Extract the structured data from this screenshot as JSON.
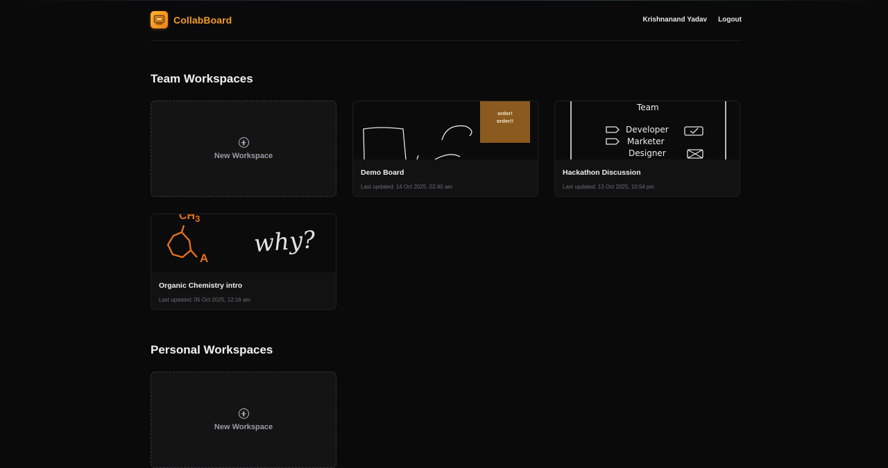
{
  "app": {
    "name": "CollabBoard",
    "brand_color": "#f39a2a"
  },
  "nav": {
    "user_name": "Krishnanand Yadav",
    "logout_label": "Logout"
  },
  "sections": {
    "team": {
      "title": "Team Workspaces",
      "new_label": "New Workspace",
      "boards": [
        {
          "title": "Demo Board",
          "updated": "Last updated: 14 Oct 2025, 02:40 am"
        },
        {
          "title": "Hackathon Discussion",
          "updated": "Last updated: 13 Oct 2025, 10:54 pm"
        },
        {
          "title": "Organic Chemistry intro",
          "updated": "Last updated: 05 Oct 2025, 12:16 am"
        }
      ]
    },
    "personal": {
      "title": "Personal Workspaces",
      "new_label": "New Workspace"
    }
  },
  "thumbnails": {
    "demo_sticky_note": "order!\norder!!",
    "hackathon": {
      "heading": "Team",
      "roles": [
        "Developer",
        "Marketer",
        "Designer"
      ]
    },
    "chemistry": {
      "formula": "CH",
      "subscript": "3",
      "atom_label": "A",
      "question": "why?"
    }
  }
}
